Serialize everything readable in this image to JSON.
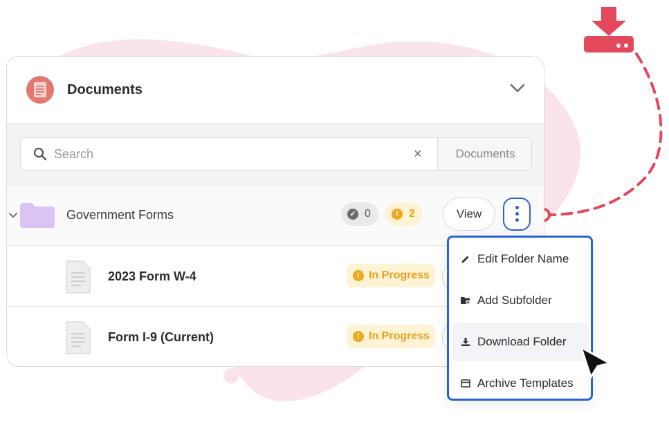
{
  "colors": {
    "accent": "#2b62d6",
    "brand": "#e3485b",
    "warning": "#f0a81e",
    "folder": "#d9c4f5"
  },
  "panel": {
    "title": "Documents",
    "icon": "document-icon",
    "collapse_icon": "chevron-down-icon"
  },
  "search": {
    "placeholder": "Search",
    "value": "",
    "clear_icon": "close-icon",
    "scope": "Documents"
  },
  "folder": {
    "name": "Government Forms",
    "approved_count": "0",
    "pending_count": "2",
    "view_label": "View",
    "more_icon": "kebab-icon"
  },
  "files": [
    {
      "name": "2023 Form W-4",
      "status": "In Progress"
    },
    {
      "name": "Form I-9 (Current)",
      "status": "In Progress"
    }
  ],
  "menu": {
    "items": [
      {
        "label": "Edit Folder Name",
        "icon": "pencil-icon"
      },
      {
        "label": "Add Subfolder",
        "icon": "folder-plus-icon"
      },
      {
        "label": "Download Folder",
        "icon": "download-icon"
      },
      {
        "label": "Archive Templates",
        "icon": "archive-icon"
      }
    ],
    "hovered": "Download Folder"
  }
}
